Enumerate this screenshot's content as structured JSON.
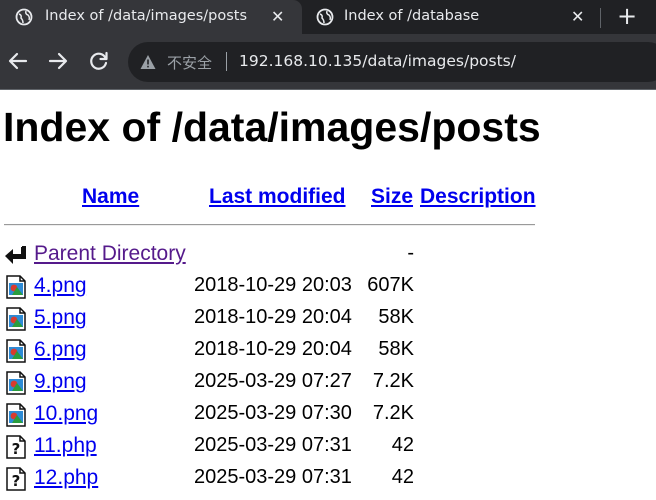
{
  "tabs": [
    {
      "title": "Index of /data/images/posts",
      "close_label": "✕",
      "active": true
    },
    {
      "title": "Index of /database",
      "close_label": "✕",
      "active": false
    }
  ],
  "new_tab_label": "+",
  "address_bar": {
    "security_label": "不安全",
    "url": "192.168.10.135/data/images/posts/"
  },
  "page": {
    "title": "Index of /data/images/posts",
    "columns": {
      "name": "Name",
      "last_modified": "Last modified",
      "size": "Size",
      "description": "Description"
    },
    "parent": {
      "name": "Parent Directory",
      "size": "-"
    },
    "entries": [
      {
        "name": "4.png",
        "modified": "2018-10-29 20:03",
        "size": "607K",
        "type": "image"
      },
      {
        "name": "5.png",
        "modified": "2018-10-29 20:04",
        "size": "58K",
        "type": "image"
      },
      {
        "name": "6.png",
        "modified": "2018-10-29 20:04",
        "size": "58K",
        "type": "image"
      },
      {
        "name": "9.png",
        "modified": "2025-03-29 07:27",
        "size": "7.2K",
        "type": "image"
      },
      {
        "name": "10.png",
        "modified": "2025-03-29 07:30",
        "size": "7.2K",
        "type": "image"
      },
      {
        "name": "11.php",
        "modified": "2025-03-29 07:31",
        "size": "42",
        "type": "unknown"
      },
      {
        "name": "12.php",
        "modified": "2025-03-29 07:31",
        "size": "42",
        "type": "unknown"
      }
    ]
  },
  "colors": {
    "link": "#0000ee",
    "visited_link": "#551a8b",
    "chrome_dark": "#202124",
    "chrome_tab": "#35363a"
  },
  "icons": {
    "tab": "globe-icon",
    "back": "arrow-left-icon",
    "forward": "arrow-right-icon",
    "reload": "reload-icon",
    "security": "warning-triangle-icon",
    "parent": "back-arrow-icon",
    "image_file": "image-file-icon",
    "unknown_file": "unknown-file-icon"
  }
}
